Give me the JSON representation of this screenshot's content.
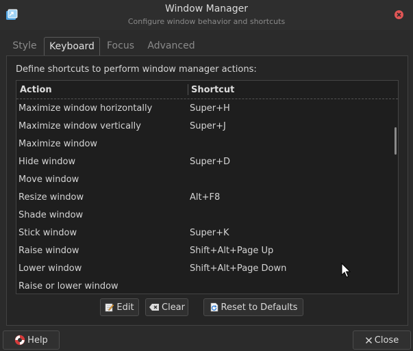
{
  "window": {
    "title": "Window Manager",
    "subtitle": "Configure window behavior and shortcuts"
  },
  "tabs": [
    {
      "label": "Style"
    },
    {
      "label": "Keyboard"
    },
    {
      "label": "Focus"
    },
    {
      "label": "Advanced"
    }
  ],
  "keyboard": {
    "description": "Define shortcuts to perform window manager actions:",
    "columns": {
      "action": "Action",
      "shortcut": "Shortcut"
    },
    "rows": [
      {
        "action": "Maximize window horizontally",
        "shortcut": "Super+H"
      },
      {
        "action": "Maximize window vertically",
        "shortcut": "Super+J"
      },
      {
        "action": "Maximize window",
        "shortcut": ""
      },
      {
        "action": "Hide window",
        "shortcut": "Super+D"
      },
      {
        "action": "Move window",
        "shortcut": ""
      },
      {
        "action": "Resize window",
        "shortcut": "Alt+F8"
      },
      {
        "action": "Shade window",
        "shortcut": ""
      },
      {
        "action": "Stick window",
        "shortcut": "Super+K"
      },
      {
        "action": "Raise window",
        "shortcut": "Shift+Alt+Page Up"
      },
      {
        "action": "Lower window",
        "shortcut": "Shift+Alt+Page Down"
      },
      {
        "action": "Raise or lower window",
        "shortcut": ""
      }
    ],
    "edit_label": "Edit",
    "clear_label": "Clear",
    "reset_label": "Reset to Defaults"
  },
  "footer": {
    "help_label": "Help",
    "close_label": "Close"
  },
  "colors": {
    "background": "#2b2b2b",
    "panel": "#252525",
    "list_background": "#1e1e1e",
    "close_icon": "#e05555"
  }
}
